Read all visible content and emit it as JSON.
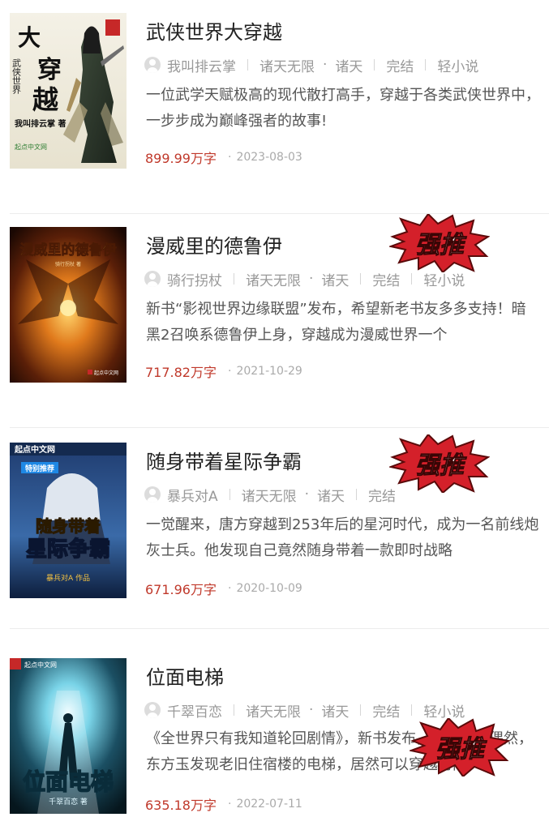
{
  "books": [
    {
      "title": "武侠世界大穿越",
      "author": "我叫排云掌",
      "category": "诸天无限",
      "subcategory": "诸天",
      "status": "完结",
      "tag": "轻小说",
      "description": "一位武学天赋极高的现代散打高手，穿越于各类武侠世界中，一步步成为巅峰强者的故事!",
      "words": "899.99万字",
      "date": "2023-08-03",
      "cover_text": [
        "大",
        "穿",
        "越",
        "武侠世界",
        "我叫排云掌 著",
        "起点中文网"
      ]
    },
    {
      "title": "漫威里的德鲁伊",
      "author": "骑行拐杖",
      "category": "诸天无限",
      "subcategory": "诸天",
      "status": "完结",
      "tag": "轻小说",
      "description": "新书“影视世界边缘联盟”发布，希望新老书友多多支持！暗黑2召唤系德鲁伊上身，穿越成为漫威世界一个",
      "words": "717.82万字",
      "date": "2021-10-29",
      "badge": "强推",
      "cover_text": [
        "漫威里的德鲁伊",
        "骑行拐杖 著",
        "起点中文网"
      ]
    },
    {
      "title": "随身带着星际争霸",
      "author": "暴兵对A",
      "category": "诸天无限",
      "subcategory": "诸天",
      "status": "完结",
      "description": "一觉醒来，唐方穿越到253年后的星河时代，成为一名前线炮灰士兵。他发现自己竟然随身带着一款即时战略",
      "words": "671.96万字",
      "date": "2020-10-09",
      "badge": "强推",
      "cover_text": [
        "起点中文网",
        "特别推荐",
        "随身带着",
        "星际争霸",
        "暴兵对A 作品"
      ]
    },
    {
      "title": "位面电梯",
      "author": "千翠百恋",
      "category": "诸天无限",
      "subcategory": "诸天",
      "status": "完结",
      "tag": "轻小说",
      "description": "《全世界只有我知道轮回剧情》，新书发布，欢迎一次偶然，东方玉发现老旧住宿楼的电梯，居然可以穿越时间，",
      "words": "635.18万字",
      "date": "2022-07-11",
      "badge": "强推",
      "cover_text": [
        "起点中文网",
        "位面电梯",
        "千翠百恋 著"
      ]
    }
  ],
  "colors": {
    "words": "#c0392b",
    "badge_red": "#d4202a",
    "divider": "#ececec"
  }
}
